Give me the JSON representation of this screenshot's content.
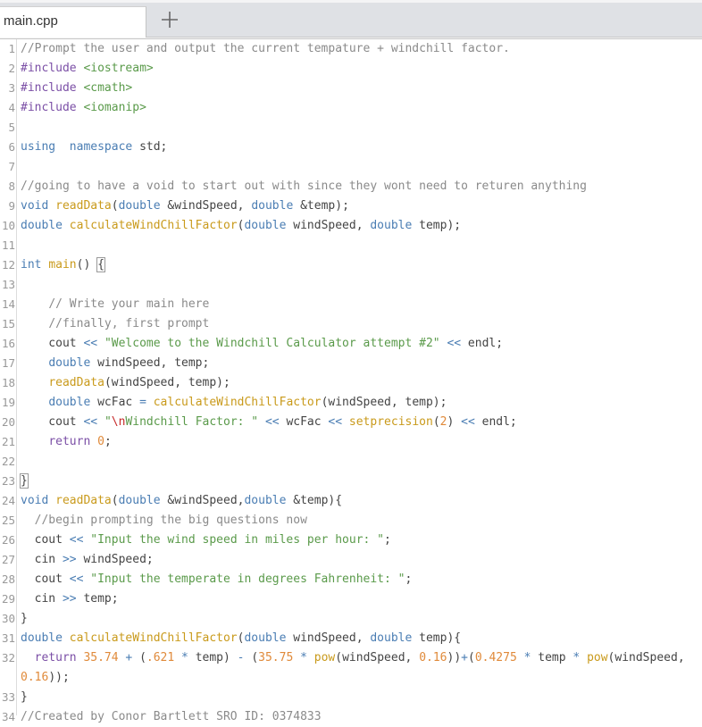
{
  "tabs": [
    {
      "label": "main.cpp",
      "active": true
    }
  ],
  "add_tab_icon": "plus-icon",
  "editor": {
    "language": "cpp",
    "lines": [
      {
        "n": "1",
        "tokens": [
          [
            "cm",
            "//Prompt the user and output the current tempature + windchill factor."
          ]
        ]
      },
      {
        "n": "2",
        "tokens": [
          [
            "pp",
            "#include "
          ],
          [
            "inc",
            "<iostream>"
          ]
        ]
      },
      {
        "n": "3",
        "tokens": [
          [
            "pp",
            "#include "
          ],
          [
            "inc",
            "<cmath>"
          ]
        ]
      },
      {
        "n": "4",
        "tokens": [
          [
            "pp",
            "#include "
          ],
          [
            "inc",
            "<iomanip>"
          ]
        ]
      },
      {
        "n": "5",
        "tokens": []
      },
      {
        "n": "6",
        "tokens": [
          [
            "kw",
            "using"
          ],
          [
            "",
            "  "
          ],
          [
            "kw",
            "namespace"
          ],
          [
            "",
            " std;"
          ]
        ]
      },
      {
        "n": "7",
        "tokens": []
      },
      {
        "n": "8",
        "tokens": [
          [
            "cm",
            "//going to have a void to start out with since they wont need to returen anything"
          ]
        ]
      },
      {
        "n": "9",
        "tokens": [
          [
            "kw",
            "void"
          ],
          [
            "",
            " "
          ],
          [
            "fn",
            "readData"
          ],
          [
            "",
            "("
          ],
          [
            "kw",
            "double"
          ],
          [
            "",
            " &windSpeed, "
          ],
          [
            "kw",
            "double"
          ],
          [
            "",
            " &temp);"
          ]
        ]
      },
      {
        "n": "10",
        "tokens": [
          [
            "kw",
            "double"
          ],
          [
            "",
            " "
          ],
          [
            "fn",
            "calculateWindChillFactor"
          ],
          [
            "",
            "("
          ],
          [
            "kw",
            "double"
          ],
          [
            "",
            " windSpeed, "
          ],
          [
            "kw",
            "double"
          ],
          [
            "",
            " temp);"
          ]
        ]
      },
      {
        "n": "11",
        "tokens": []
      },
      {
        "n": "12",
        "tokens": [
          [
            "kw",
            "int"
          ],
          [
            "",
            " "
          ],
          [
            "fn",
            "main"
          ],
          [
            "",
            "() "
          ],
          [
            "brk",
            "{"
          ]
        ]
      },
      {
        "n": "13",
        "tokens": []
      },
      {
        "n": "14",
        "tokens": [
          [
            "",
            "    "
          ],
          [
            "cm",
            "// Write your main here"
          ]
        ]
      },
      {
        "n": "15",
        "tokens": [
          [
            "",
            "    "
          ],
          [
            "cm",
            "//finally, first prompt"
          ]
        ]
      },
      {
        "n": "16",
        "tokens": [
          [
            "",
            "    cout "
          ],
          [
            "op",
            "<<"
          ],
          [
            "",
            " "
          ],
          [
            "str",
            "\"Welcome to the Windchill Calculator attempt #2\""
          ],
          [
            "",
            " "
          ],
          [
            "op",
            "<<"
          ],
          [
            "",
            " endl;"
          ]
        ]
      },
      {
        "n": "17",
        "tokens": [
          [
            "",
            "    "
          ],
          [
            "kw",
            "double"
          ],
          [
            "",
            " windSpeed, temp;"
          ]
        ]
      },
      {
        "n": "18",
        "tokens": [
          [
            "",
            "    "
          ],
          [
            "fn",
            "readData"
          ],
          [
            "",
            "(windSpeed, temp);"
          ]
        ]
      },
      {
        "n": "19",
        "tokens": [
          [
            "",
            "    "
          ],
          [
            "kw",
            "double"
          ],
          [
            "",
            " wcFac "
          ],
          [
            "op",
            "="
          ],
          [
            "",
            " "
          ],
          [
            "fn",
            "calculateWindChillFactor"
          ],
          [
            "",
            "(windSpeed, temp);"
          ]
        ]
      },
      {
        "n": "20",
        "tokens": [
          [
            "",
            "    cout "
          ],
          [
            "op",
            "<<"
          ],
          [
            "",
            " "
          ],
          [
            "str",
            "\""
          ],
          [
            "esc",
            "\\n"
          ],
          [
            "str",
            "Windchill Factor: \""
          ],
          [
            "",
            " "
          ],
          [
            "op",
            "<<"
          ],
          [
            "",
            " wcFac "
          ],
          [
            "op",
            "<<"
          ],
          [
            "",
            " "
          ],
          [
            "fn",
            "setprecision"
          ],
          [
            "",
            "("
          ],
          [
            "num",
            "2"
          ],
          [
            "",
            ") "
          ],
          [
            "op",
            "<<"
          ],
          [
            "",
            " endl;"
          ]
        ]
      },
      {
        "n": "21",
        "tokens": [
          [
            "",
            "    "
          ],
          [
            "ret",
            "return"
          ],
          [
            "",
            " "
          ],
          [
            "num",
            "0"
          ],
          [
            "",
            ";"
          ]
        ]
      },
      {
        "n": "22",
        "tokens": []
      },
      {
        "n": "23",
        "tokens": [
          [
            "brk",
            "}"
          ]
        ]
      },
      {
        "n": "24",
        "tokens": [
          [
            "kw",
            "void"
          ],
          [
            "",
            " "
          ],
          [
            "fn",
            "readData"
          ],
          [
            "",
            "("
          ],
          [
            "kw",
            "double"
          ],
          [
            "",
            " &windSpeed,"
          ],
          [
            "kw",
            "double"
          ],
          [
            "",
            " &temp){"
          ]
        ]
      },
      {
        "n": "25",
        "tokens": [
          [
            "",
            "  "
          ],
          [
            "cm",
            "//begin prompting the big questions now"
          ]
        ]
      },
      {
        "n": "26",
        "tokens": [
          [
            "",
            "  cout "
          ],
          [
            "op",
            "<<"
          ],
          [
            "",
            " "
          ],
          [
            "str",
            "\"Input the wind speed in miles per hour: \""
          ],
          [
            "",
            ";"
          ]
        ]
      },
      {
        "n": "27",
        "tokens": [
          [
            "",
            "  cin "
          ],
          [
            "op",
            ">>"
          ],
          [
            "",
            " windSpeed;"
          ]
        ]
      },
      {
        "n": "28",
        "tokens": [
          [
            "",
            "  cout "
          ],
          [
            "op",
            "<<"
          ],
          [
            "",
            " "
          ],
          [
            "str",
            "\"Input the temperate in degrees Fahrenheit: \""
          ],
          [
            "",
            ";"
          ]
        ]
      },
      {
        "n": "29",
        "tokens": [
          [
            "",
            "  cin "
          ],
          [
            "op",
            ">>"
          ],
          [
            "",
            " temp;"
          ]
        ]
      },
      {
        "n": "30",
        "tokens": [
          [
            "",
            "}"
          ]
        ]
      },
      {
        "n": "31",
        "tokens": [
          [
            "kw",
            "double"
          ],
          [
            "",
            " "
          ],
          [
            "fn",
            "calculateWindChillFactor"
          ],
          [
            "",
            "("
          ],
          [
            "kw",
            "double"
          ],
          [
            "",
            " windSpeed, "
          ],
          [
            "kw",
            "double"
          ],
          [
            "",
            " temp){"
          ]
        ]
      },
      {
        "n": "32",
        "tokens": [
          [
            "",
            "  "
          ],
          [
            "ret",
            "return"
          ],
          [
            "",
            " "
          ],
          [
            "num",
            "35.74"
          ],
          [
            "",
            " "
          ],
          [
            "op",
            "+"
          ],
          [
            "",
            " ("
          ],
          [
            "num",
            ".621"
          ],
          [
            "",
            " "
          ],
          [
            "op",
            "*"
          ],
          [
            "",
            " temp) "
          ],
          [
            "op",
            "-"
          ],
          [
            "",
            " ("
          ],
          [
            "num",
            "35.75"
          ],
          [
            "",
            " "
          ],
          [
            "op",
            "*"
          ],
          [
            "",
            " "
          ],
          [
            "fn",
            "pow"
          ],
          [
            "",
            "(windSpeed, "
          ],
          [
            "num",
            "0.16"
          ],
          [
            "",
            "))"
          ],
          [
            "op",
            "+"
          ],
          [
            "",
            "("
          ],
          [
            "num",
            "0.4275"
          ],
          [
            "",
            " "
          ],
          [
            "op",
            "*"
          ],
          [
            "",
            " temp "
          ],
          [
            "op",
            "*"
          ],
          [
            "",
            " "
          ],
          [
            "fn",
            "pow"
          ],
          [
            "",
            "(windSpeed,"
          ]
        ]
      },
      {
        "n": "",
        "tokens": [
          [
            "num",
            "0.16"
          ],
          [
            "",
            "));"
          ]
        ]
      },
      {
        "n": "33",
        "tokens": [
          [
            "",
            "}"
          ]
        ]
      },
      {
        "n": "34",
        "tokens": [
          [
            "cm",
            "//Created by Conor Bartlett SRO ID: 0374833"
          ]
        ]
      }
    ]
  }
}
